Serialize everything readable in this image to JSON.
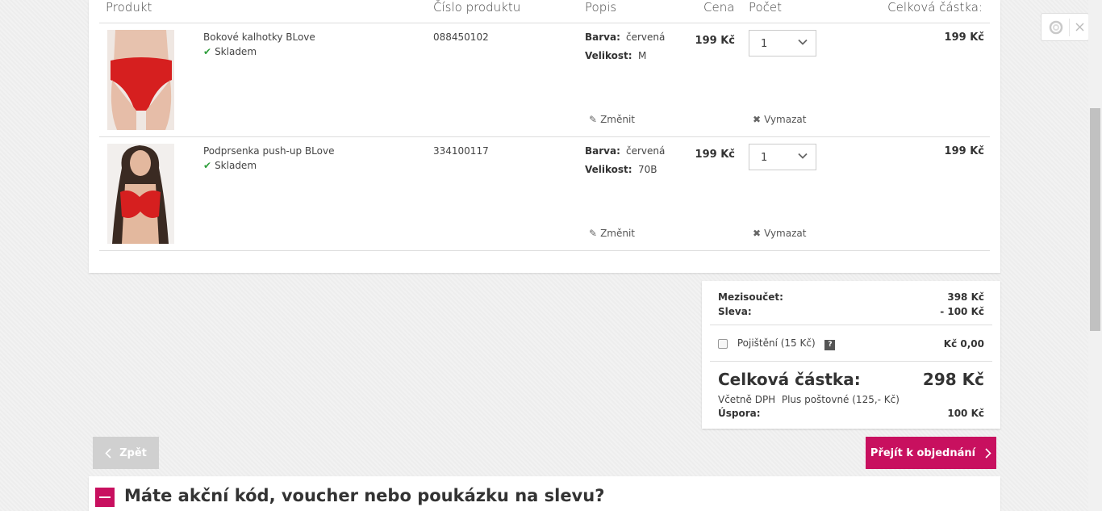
{
  "table": {
    "headers": {
      "product": "Produkt",
      "number": "Číslo produktu",
      "description": "Popis",
      "price": "Cena",
      "quantity": "Počet",
      "total": "Celková částka:"
    },
    "items": [
      {
        "name": "Bokové kalhotky BLove",
        "stock": "Skladem",
        "number": "088450102",
        "color_label": "Barva:",
        "color": "červená",
        "size_label": "Velikost:",
        "size": "M",
        "price": "199 Kč",
        "qty": "1",
        "total": "199 Kč",
        "edit": "Změnit",
        "remove": "Vymazat"
      },
      {
        "name": "Podprsenka push-up BLove",
        "stock": "Skladem",
        "number": "334100117",
        "color_label": "Barva:",
        "color": "červená",
        "size_label": "Velikost:",
        "size": "70B",
        "price": "199 Kč",
        "qty": "1",
        "total": "199 Kč",
        "edit": "Změnit",
        "remove": "Vymazat"
      }
    ]
  },
  "summary": {
    "subtotal_label": "Mezisoučet:",
    "subtotal": "398 Kč",
    "discount_label": "Sleva:",
    "discount": "- 100 Kč",
    "insurance_label": "Pojištění (15 Kč)",
    "insurance_help": "?",
    "insurance_value": "Kč 0,00",
    "total_label": "Celková částka:",
    "total": "298 Kč",
    "vat_note": "Včetně DPH",
    "shipping_note": "Plus poštovné (125,- Kč)",
    "savings_label": "Úspora:",
    "savings": "100 Kč"
  },
  "buttons": {
    "back": "Zpět",
    "order": "Přejít k objednání"
  },
  "voucher": {
    "title": "Máte akční kód, voucher nebo poukázku na slevu?"
  },
  "colors": {
    "accent": "#c8105f",
    "stock_green": "#2e9e3b"
  }
}
